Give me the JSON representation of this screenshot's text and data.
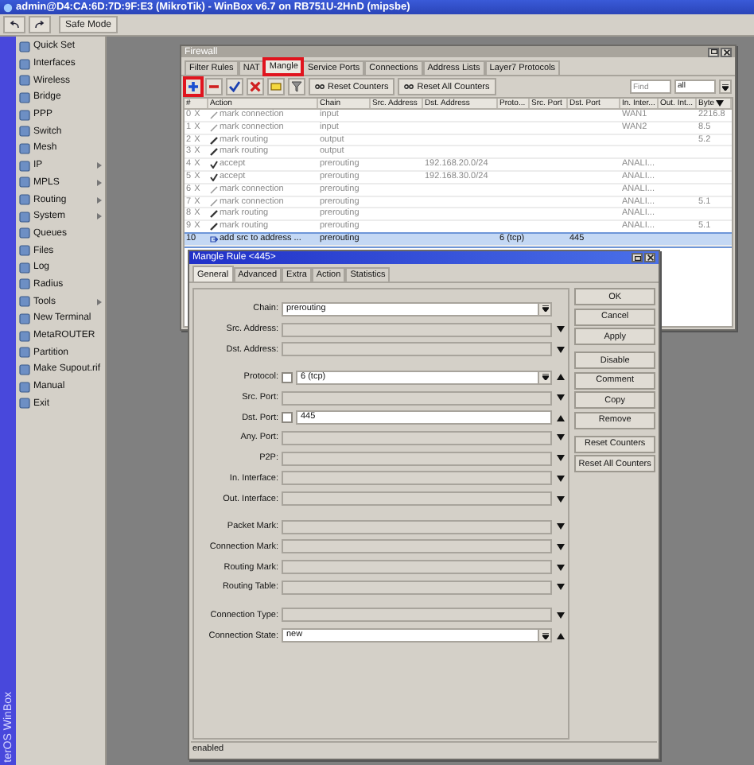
{
  "window": {
    "title": "admin@D4:CA:6D:7D:9F:E3 (MikroTik) - WinBox v6.7 on RB751U-2HnD (mipsbe)"
  },
  "toolbar": {
    "safe_mode": "Safe Mode"
  },
  "side_banner": "terOS WinBox",
  "sidebar": {
    "items": [
      {
        "label": "Quick Set",
        "submenu": false
      },
      {
        "label": "Interfaces",
        "submenu": false
      },
      {
        "label": "Wireless",
        "submenu": false
      },
      {
        "label": "Bridge",
        "submenu": false
      },
      {
        "label": "PPP",
        "submenu": false
      },
      {
        "label": "Switch",
        "submenu": false
      },
      {
        "label": "Mesh",
        "submenu": false
      },
      {
        "label": "IP",
        "submenu": true
      },
      {
        "label": "MPLS",
        "submenu": true
      },
      {
        "label": "Routing",
        "submenu": true
      },
      {
        "label": "System",
        "submenu": true
      },
      {
        "label": "Queues",
        "submenu": false
      },
      {
        "label": "Files",
        "submenu": false
      },
      {
        "label": "Log",
        "submenu": false
      },
      {
        "label": "Radius",
        "submenu": false
      },
      {
        "label": "Tools",
        "submenu": true
      },
      {
        "label": "New Terminal",
        "submenu": false
      },
      {
        "label": "MetaROUTER",
        "submenu": false
      },
      {
        "label": "Partition",
        "submenu": false
      },
      {
        "label": "Make Supout.rif",
        "submenu": false
      },
      {
        "label": "Manual",
        "submenu": false
      },
      {
        "label": "Exit",
        "submenu": false
      }
    ]
  },
  "firewall": {
    "title": "Firewall",
    "tabs": [
      {
        "label": "Filter Rules",
        "selected": false,
        "highlighted": false
      },
      {
        "label": "NAT",
        "selected": false,
        "highlighted": false
      },
      {
        "label": "Mangle",
        "selected": true,
        "highlighted": true
      },
      {
        "label": "Service Ports",
        "selected": false,
        "highlighted": false
      },
      {
        "label": "Connections",
        "selected": false,
        "highlighted": false
      },
      {
        "label": "Address Lists",
        "selected": false,
        "highlighted": false
      },
      {
        "label": "Layer7 Protocols",
        "selected": false,
        "highlighted": false
      }
    ],
    "tools": [
      {
        "kind": "add",
        "highlighted": true
      },
      {
        "kind": "remove",
        "highlighted": false
      },
      {
        "kind": "enable",
        "highlighted": false
      },
      {
        "kind": "disable",
        "highlighted": false
      },
      {
        "kind": "comment",
        "highlighted": false
      },
      {
        "kind": "filter",
        "highlighted": false
      }
    ],
    "counter_buttons": [
      "Reset Counters",
      "Reset All Counters"
    ],
    "find": {
      "placeholder": "Find"
    },
    "filter_value": "all",
    "table": {
      "columns": [
        "#",
        "Action",
        "Chain",
        "Src. Address",
        "Dst. Address",
        "Proto...",
        "Src. Port",
        "Dst. Port",
        "In. Inter...",
        "Out. Int...",
        "Byte"
      ],
      "rows": [
        {
          "number": "0",
          "flag": "X",
          "kind": "mark_connection",
          "action": "mark connection",
          "chain": "input",
          "in_interface": "WAN1",
          "bytes": "2216.8",
          "disabled": true,
          "selected": false
        },
        {
          "number": "1",
          "flag": "X",
          "kind": "mark_connection",
          "action": "mark connection",
          "chain": "input",
          "in_interface": "WAN2",
          "bytes": "8.5",
          "disabled": true,
          "selected": false
        },
        {
          "number": "2",
          "flag": "X",
          "kind": "mark_routing",
          "action": "mark routing",
          "chain": "output",
          "bytes": "5.2",
          "disabled": true,
          "selected": false
        },
        {
          "number": "3",
          "flag": "X",
          "kind": "mark_routing",
          "action": "mark routing",
          "chain": "output",
          "disabled": true,
          "selected": false
        },
        {
          "number": "4",
          "flag": "X",
          "kind": "accept",
          "action": "accept",
          "chain": "prerouting",
          "dst_address": "192.168.20.0/24",
          "in_interface": "ANALI...",
          "disabled": true,
          "selected": false
        },
        {
          "number": "5",
          "flag": "X",
          "kind": "accept",
          "action": "accept",
          "chain": "prerouting",
          "dst_address": "192.168.30.0/24",
          "in_interface": "ANALI...",
          "disabled": true,
          "selected": false
        },
        {
          "number": "6",
          "flag": "X",
          "kind": "mark_connection",
          "action": "mark connection",
          "chain": "prerouting",
          "in_interface": "ANALI...",
          "disabled": true,
          "selected": false
        },
        {
          "number": "7",
          "flag": "X",
          "kind": "mark_connection",
          "action": "mark connection",
          "chain": "prerouting",
          "in_interface": "ANALI...",
          "bytes": "5.1",
          "disabled": true,
          "selected": false
        },
        {
          "number": "8",
          "flag": "X",
          "kind": "mark_routing",
          "action": "mark routing",
          "chain": "prerouting",
          "in_interface": "ANALI...",
          "disabled": true,
          "selected": false
        },
        {
          "number": "9",
          "flag": "X",
          "kind": "mark_routing",
          "action": "mark routing",
          "chain": "prerouting",
          "in_interface": "ANALI...",
          "bytes": "5.1",
          "disabled": true,
          "selected": false
        },
        {
          "number": "10",
          "kind": "add_src",
          "action": "add src to address ...",
          "chain": "prerouting",
          "protocol": "6 (tcp)",
          "dst_port": "445",
          "disabled": false,
          "selected": true
        }
      ]
    }
  },
  "mangle_rule": {
    "title": "Mangle Rule <445>",
    "tabs": [
      {
        "label": "General",
        "selected": true
      },
      {
        "label": "Advanced",
        "selected": false
      },
      {
        "label": "Extra",
        "selected": false
      },
      {
        "label": "Action",
        "selected": false
      },
      {
        "label": "Statistics",
        "selected": false
      }
    ],
    "field_groups": [
      {
        "fields": [
          {
            "label": "Chain:",
            "kind": "combo",
            "value": "prerouting"
          },
          {
            "label": "Src. Address:",
            "kind": "empty"
          },
          {
            "label": "Dst. Address:",
            "kind": "empty"
          }
        ]
      },
      {
        "fields": [
          {
            "label": "Protocol:",
            "kind": "combo_not",
            "value": "6 (tcp)",
            "checked": false
          },
          {
            "label": "Src. Port:",
            "kind": "empty"
          },
          {
            "label": "Dst. Port:",
            "kind": "text_not",
            "value": "445",
            "checked": false
          },
          {
            "label": "Any. Port:",
            "kind": "empty"
          },
          {
            "label": "P2P:",
            "kind": "empty"
          },
          {
            "label": "In. Interface:",
            "kind": "empty"
          },
          {
            "label": "Out. Interface:",
            "kind": "empty"
          }
        ]
      },
      {
        "fields": [
          {
            "label": "Packet Mark:",
            "kind": "empty"
          },
          {
            "label": "Connection Mark:",
            "kind": "empty"
          },
          {
            "label": "Routing Mark:",
            "kind": "empty"
          },
          {
            "label": "Routing Table:",
            "kind": "empty"
          }
        ]
      },
      {
        "fields": [
          {
            "label": "Connection Type:",
            "kind": "empty"
          },
          {
            "label": "Connection State:",
            "kind": "combo_up",
            "value": "new"
          }
        ]
      }
    ],
    "button_groups": [
      {
        "buttons": [
          "OK",
          "Cancel",
          "Apply"
        ]
      },
      {
        "buttons": [
          "Disable",
          "Comment",
          "Copy",
          "Remove"
        ]
      },
      {
        "buttons": [
          "Reset Counters",
          "Reset All Counters"
        ]
      }
    ],
    "status": "enabled"
  }
}
